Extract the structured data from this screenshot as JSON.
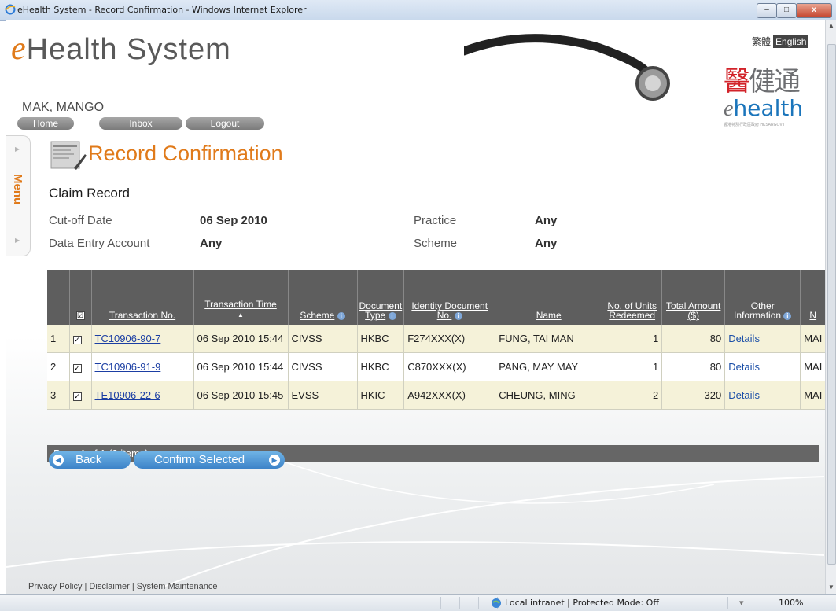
{
  "window": {
    "title": "eHealth System - Record Confirmation - Windows Internet Explorer",
    "min": "–",
    "max": "□",
    "close": "x"
  },
  "header": {
    "logo_e": "e",
    "logo_text": "Health System",
    "lang_tc": "繁體",
    "lang_en": "English",
    "brand_cn1": "醫",
    "brand_cn2": "健通",
    "brand_e": "e",
    "brand_health": "health",
    "brand_sub": "香港特別行政區政府 HKSARGOVT",
    "user": "MAK, MANGO"
  },
  "nav": {
    "home": "Home",
    "inbox": "Inbox",
    "logout": "Logout"
  },
  "menu": {
    "label": "Menu"
  },
  "page": {
    "title": "Record Confirmation",
    "section": "Claim Record"
  },
  "filters": {
    "cutoff_label": "Cut-off Date",
    "cutoff_value": "06 Sep 2010",
    "practice_label": "Practice",
    "practice_value": "Any",
    "account_label": "Data Entry Account",
    "account_value": "Any",
    "scheme_label": "Scheme",
    "scheme_value": "Any"
  },
  "table": {
    "headers": {
      "select_all": "☑",
      "txn": "Transaction No.",
      "time": "Transaction Time",
      "scheme": "Scheme",
      "doctype": "Document Type",
      "docno": "Identity Document No.",
      "name": "Name",
      "units": "No. of Units Redeemed",
      "amount": "Total Amount ($)",
      "other": "Other Information",
      "next": "N"
    },
    "rows": [
      {
        "n": "1",
        "txn": "TC10906-90-7",
        "time": "06 Sep 2010 15:44",
        "scheme": "CIVSS",
        "doctype": "HKBC",
        "docno": "F274XXX(X)",
        "name": "FUNG, TAI MAN",
        "units": "1",
        "amount": "80",
        "other": "Details",
        "next": "MAI"
      },
      {
        "n": "2",
        "txn": "TC10906-91-9",
        "time": "06 Sep 2010 15:44",
        "scheme": "CIVSS",
        "doctype": "HKBC",
        "docno": "C870XXX(X)",
        "name": "PANG, MAY MAY",
        "units": "1",
        "amount": "80",
        "other": "Details",
        "next": "MAI"
      },
      {
        "n": "3",
        "txn": "TE10906-22-6",
        "time": "06 Sep 2010 15:45",
        "scheme": "EVSS",
        "doctype": "HKIC",
        "docno": "A942XXX(X)",
        "name": "CHEUNG, MING",
        "units": "2",
        "amount": "320",
        "other": "Details",
        "next": "MAI"
      }
    ],
    "pager": "Page 1 of 1 (3 items)"
  },
  "actions": {
    "back": "Back",
    "confirm": "Confirm Selected"
  },
  "footer": "Privacy Policy | Disclaimer | System Maintenance",
  "status": {
    "zone": "Local intranet | Protected Mode: Off",
    "zoom": "100%",
    "sec": "▾"
  }
}
